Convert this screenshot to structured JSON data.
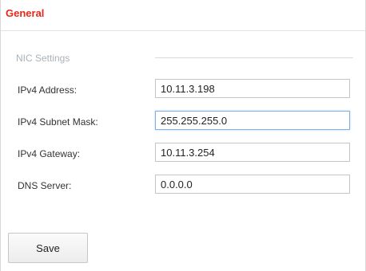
{
  "panel": {
    "title": "General"
  },
  "section": {
    "title": "NIC Settings"
  },
  "fields": [
    {
      "label": "IPv4 Address:",
      "value": "10.11.3.198"
    },
    {
      "label": "IPv4 Subnet Mask:",
      "value": "255.255.255.0"
    },
    {
      "label": "IPv4 Gateway:",
      "value": "10.11.3.254"
    },
    {
      "label": "DNS Server:",
      "value": "0.0.0.0"
    }
  ],
  "actions": {
    "save_label": "Save"
  },
  "colors": {
    "title": "#e8271b",
    "section_label": "#a9b2ba",
    "focus_border": "#7fb2e0"
  }
}
